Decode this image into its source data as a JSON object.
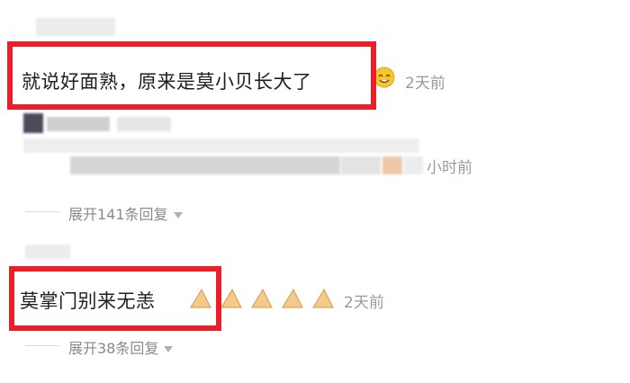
{
  "comments": [
    {
      "text": "就说好面熟，原来是莫小贝长大了",
      "time": "2天前",
      "expand_label": "展开141条回复"
    },
    {
      "text": "莫掌门别来无恙",
      "time": "2天前",
      "expand_label": "展开38条回复"
    }
  ],
  "reply": {
    "time": "小时前"
  },
  "colors": {
    "highlight": "#e8202a",
    "meta_text": "#9a9a9a"
  },
  "icons": [
    "smile-emoji-icon",
    "clap-emoji-icon",
    "caret-down-icon"
  ]
}
